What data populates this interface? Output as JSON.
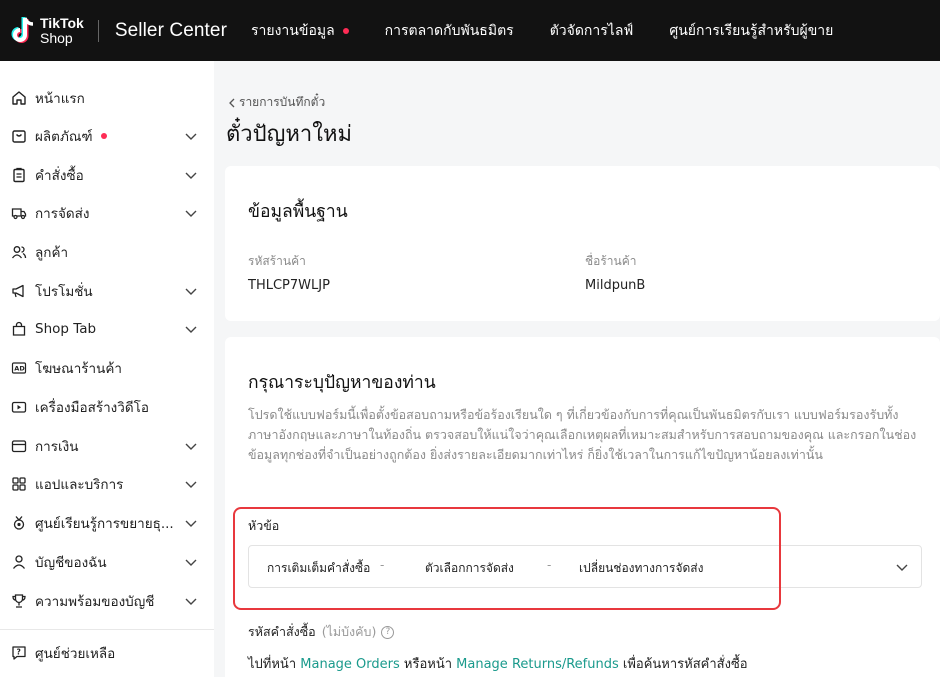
{
  "header": {
    "logo_line1": "TikTok",
    "logo_line2": "Shop",
    "app_title": "Seller Center",
    "nav": [
      {
        "label": "รายงานข้อมูล",
        "badge": true
      },
      {
        "label": "การตลาดกับพันธมิตร"
      },
      {
        "label": "ตัวจัดการไลฟ์"
      },
      {
        "label": "ศูนย์การเรียนรู้สำหรับผู้ขาย"
      }
    ]
  },
  "sidebar": {
    "items": [
      {
        "label": "หน้าแรก",
        "icon": "home-icon"
      },
      {
        "label": "ผลิตภัณฑ์",
        "icon": "product-icon",
        "badge": true,
        "expandable": true
      },
      {
        "label": "คำสั่งซื้อ",
        "icon": "clipboard-icon",
        "expandable": true
      },
      {
        "label": "การจัดส่ง",
        "icon": "truck-icon",
        "expandable": true
      },
      {
        "label": "ลูกค้า",
        "icon": "customers-icon"
      },
      {
        "label": "โปรโมชั่น",
        "icon": "megaphone-icon",
        "expandable": true
      },
      {
        "label": "Shop Tab",
        "icon": "shopping-bag-icon",
        "expandable": true
      },
      {
        "label": "โฆษณาร้านค้า",
        "icon": "ad-icon"
      },
      {
        "label": "เครื่องมือสร้างวิดีโอ",
        "icon": "video-icon"
      },
      {
        "label": "การเงิน",
        "icon": "wallet-icon",
        "expandable": true
      },
      {
        "label": "แอปและบริการ",
        "icon": "apps-grid-icon",
        "expandable": true
      },
      {
        "label": "ศูนย์เรียนรู้การขยายธุ...",
        "icon": "medal-icon",
        "expandable": true
      },
      {
        "label": "บัญชีของฉัน",
        "icon": "user-icon",
        "expandable": true
      },
      {
        "label": "ความพร้อมของบัญชี",
        "icon": "trophy-icon",
        "expandable": true
      }
    ],
    "help": {
      "label": "ศูนย์ช่วยเหลือ",
      "icon": "help-icon"
    }
  },
  "main": {
    "back_label": "รายการบันทึกตั๋ว",
    "page_title": "ตั๋วปัญหาใหม่",
    "basic_info": {
      "title": "ข้อมูลพื้นฐาน",
      "shop_code_label": "รหัสร้านค้า",
      "shop_code_value": "THLCP7WLJP",
      "shop_name_label": "ชื่อร้านค้า",
      "shop_name_value": "MildpunB"
    },
    "issue": {
      "title": "กรุณาระบุปัญหาของท่าน",
      "description": "โปรดใช้แบบฟอร์มนี้เพื่อตั้งข้อสอบถามหรือข้อร้องเรียนใด ๆ ที่เกี่ยวข้องกับการที่คุณเป็นพันธมิตรกับเรา แบบฟอร์มรองรับทั้งภาษาอังกฤษและภาษาในท้องถิ่น ตรวจสอบให้แน่ใจว่าคุณเลือกเหตุผลที่เหมาะสมสำหรับการสอบถามของคุณ และกรอกในช่องข้อมูลทุกช่องที่จำเป็นอย่างถูกต้อง ยิ่งส่งรายละเอียดมากเท่าไหร่ ก็ยิ่งใช้เวลาในการแก้ไขปัญหาน้อยลงเท่านั้น",
      "topic_label": "หัวข้อ",
      "topic_path": [
        "การเติมเต็มคำสั่งซื้อ",
        "ตัวเลือกการจัดส่ง",
        "เปลี่ยนช่องทางการจัดส่ง"
      ],
      "separator": "-",
      "order_id_label": "รหัสคำสั่งซื้อ",
      "order_id_optional": "(ไม่บังคับ)",
      "hint_prefix": "ไปที่หน้า",
      "hint_link1": "Manage Orders",
      "hint_middle": "หรือหน้า",
      "hint_link2": "Manage Returns/Refunds",
      "hint_suffix": "เพื่อค้นหารหัสคำสั่งซื้อ"
    }
  },
  "colors": {
    "topbar": "#121212",
    "badge": "#fe2c55",
    "link": "#1a9a8c",
    "highlight": "#e8383d"
  }
}
